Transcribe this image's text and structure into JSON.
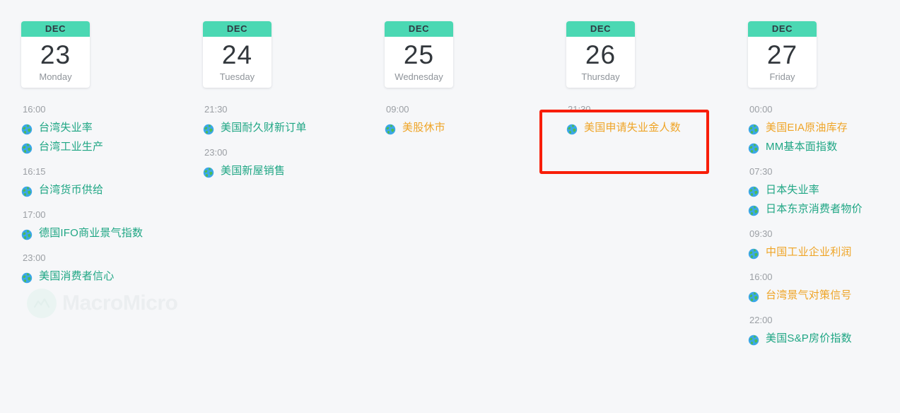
{
  "watermark": {
    "brand": "MacroMicro",
    "logo_icon": "mountain-wave-icon"
  },
  "colors": {
    "month_header_bg": "#4bd8b3",
    "event_green": "#1fa684",
    "event_orange": "#efa426",
    "highlight_border": "#f81e09",
    "page_bg": "#f6f7f9",
    "time_label": "#9b9fa4"
  },
  "highlight": {
    "label": "highlighted-event-box",
    "target_day_index": 3,
    "target_event": "美国申请失业金人数"
  },
  "days": [
    {
      "month": "DEC",
      "day_number": "23",
      "weekday": "Monday",
      "groups": [
        {
          "time": "16:00",
          "events": [
            {
              "icon": "globe-icon",
              "name": "台湾失业率",
              "color": "green"
            },
            {
              "icon": "globe-icon",
              "name": "台湾工业生产",
              "color": "green"
            }
          ]
        },
        {
          "time": "16:15",
          "events": [
            {
              "icon": "globe-icon",
              "name": "台湾货币供给",
              "color": "green"
            }
          ]
        },
        {
          "time": "17:00",
          "events": [
            {
              "icon": "globe-icon",
              "name": "德国IFO商业景气指数",
              "color": "green"
            }
          ]
        },
        {
          "time": "23:00",
          "events": [
            {
              "icon": "globe-icon",
              "name": "美国消费者信心",
              "color": "green"
            }
          ]
        }
      ]
    },
    {
      "month": "DEC",
      "day_number": "24",
      "weekday": "Tuesday",
      "groups": [
        {
          "time": "21:30",
          "events": [
            {
              "icon": "globe-icon",
              "name": "美国耐久财新订单",
              "color": "green"
            }
          ]
        },
        {
          "time": "23:00",
          "events": [
            {
              "icon": "globe-icon",
              "name": "美国新屋销售",
              "color": "green"
            }
          ]
        }
      ]
    },
    {
      "month": "DEC",
      "day_number": "25",
      "weekday": "Wednesday",
      "groups": [
        {
          "time": "09:00",
          "events": [
            {
              "icon": "globe-icon",
              "name": "美股休市",
              "color": "orange"
            }
          ]
        }
      ]
    },
    {
      "month": "DEC",
      "day_number": "26",
      "weekday": "Thursday",
      "groups": [
        {
          "time": "21:30",
          "events": [
            {
              "icon": "globe-icon",
              "name": "美国申请失业金人数",
              "color": "orange"
            }
          ]
        }
      ]
    },
    {
      "month": "DEC",
      "day_number": "27",
      "weekday": "Friday",
      "groups": [
        {
          "time": "00:00",
          "events": [
            {
              "icon": "globe-icon",
              "name": "美国EIA原油库存",
              "color": "orange"
            },
            {
              "icon": "globe-icon",
              "name": "MM基本面指数",
              "color": "green"
            }
          ]
        },
        {
          "time": "07:30",
          "events": [
            {
              "icon": "globe-icon",
              "name": "日本失业率",
              "color": "green"
            },
            {
              "icon": "globe-icon",
              "name": "日本东京消费者物价",
              "color": "green"
            }
          ]
        },
        {
          "time": "09:30",
          "events": [
            {
              "icon": "globe-icon",
              "name": "中国工业企业利润",
              "color": "orange"
            }
          ]
        },
        {
          "time": "16:00",
          "events": [
            {
              "icon": "globe-icon",
              "name": "台湾景气对策信号",
              "color": "orange"
            }
          ]
        },
        {
          "time": "22:00",
          "events": [
            {
              "icon": "globe-icon",
              "name": "美国S&P房价指数",
              "color": "green"
            }
          ]
        }
      ]
    }
  ]
}
